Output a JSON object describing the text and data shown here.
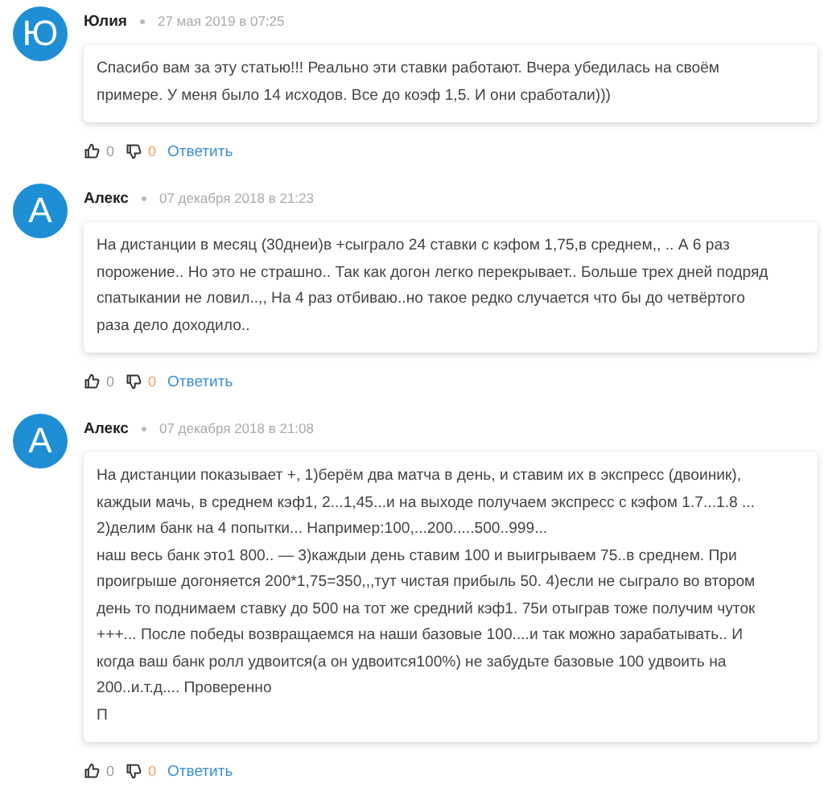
{
  "comments": [
    {
      "avatar": "Ю",
      "author": "Юлия",
      "date": "27 мая 2019 в 07:25",
      "text": "Спасибо вам за эту статью!!! Реально эти ставки работают. Вчера убедилась на своём\nпримере. У меня было 14 исходов. Все до коэф 1,5. И они сработали)))",
      "likes": "0",
      "dislikes": "0",
      "reply": "Ответить"
    },
    {
      "avatar": "А",
      "author": "Алекс",
      "date": "07 декабря 2018 в 21:23",
      "text": "На дистанции в месяц (30днеи)в +сыграло 24 ставки с кэфом 1,75,в среднем,, .. А 6 раз\nпорожение.. Но это не страшно.. Так как догон легко перекрывает.. Больше трех дней подряд\nспатыкании не ловил..,, На 4 раз отбиваю..но такое редко случается что бы до четвёртого\nраза дело доходило..",
      "likes": "0",
      "dislikes": "0",
      "reply": "Ответить"
    },
    {
      "avatar": "А",
      "author": "Алекс",
      "date": "07 декабря 2018 в 21:08",
      "text": "На дистанции показывает +, 1)берём два матча в день, и ставим их в экспресс (двоиник),\nкаждыи мачь, в среднем кэф1, 2...1,45...и на выходе получаем экспресс с кэфом 1.7...1.8 ...\n2)делим банк на 4 попытки... Например:100,...200.....500..999...\nнаш весь банк это1 800.. — 3)каждыи день ставим 100 и выигрываем 75..в среднем. При\nпроигрыше догоняется 200*1,75=350,,,тут чистая прибыль 50. 4)если не сыграло во втором\nдень то поднимаем ставку до 500 на тот же средний кэф1. 75и отыграв тоже получим чуток\n+++... После победы возвращаемся на наши базовые 100....и так можно зарабатывать.. И\nкогда ваш банк ролл удвоится(а он удвоится100%) не забудьте базовые 100 удвоить на\n200..и.т.д.... Проверенно\nП",
      "likes": "0",
      "dislikes": "0",
      "reply": "Ответить"
    }
  ]
}
